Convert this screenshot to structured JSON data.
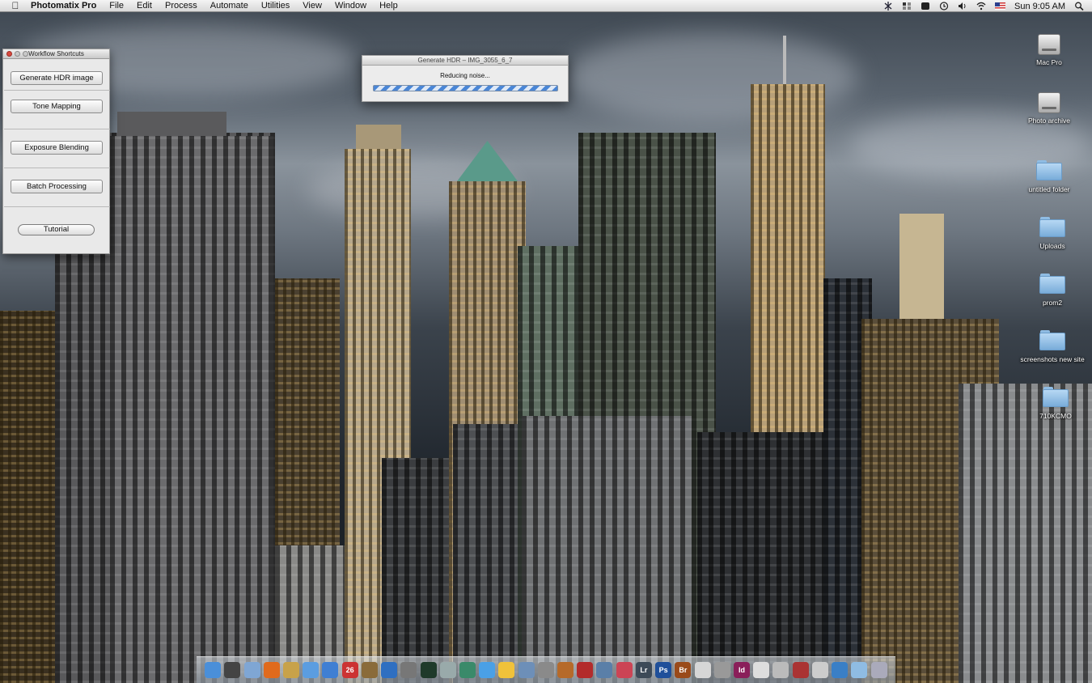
{
  "menubar": {
    "apple_icon": "apple-icon",
    "app_name": "Photomatix Pro",
    "menus": [
      "File",
      "Edit",
      "Process",
      "Automate",
      "Utilities",
      "View",
      "Window",
      "Help"
    ],
    "clock": "Sun 9:05 AM",
    "status_icons": [
      "bluetooth-icon",
      "spaces-icon",
      "timemachine-icon",
      "volume-icon",
      "wifi-icon",
      "us-flag-icon",
      "spotlight-icon"
    ]
  },
  "workflow": {
    "title": "Workflow Shortcuts",
    "buttons": {
      "generate_hdr": "Generate HDR image",
      "tone_mapping": "Tone Mapping",
      "exposure_blending": "Exposure Blending",
      "batch_processing": "Batch Processing",
      "tutorial": "Tutorial"
    }
  },
  "hdr_window": {
    "title": "Generate HDR – IMG_3055_6_7",
    "status": "Reducing noise..."
  },
  "desktop_icons": [
    {
      "label": "Mac Pro",
      "type": "drive"
    },
    {
      "label": "Photo archive",
      "type": "drive"
    },
    {
      "label": "untitled folder",
      "type": "folder"
    },
    {
      "label": "Uploads",
      "type": "folder"
    },
    {
      "label": "prom2",
      "type": "folder"
    },
    {
      "label": "screenshots new site",
      "type": "folder"
    },
    {
      "label": "710KCMO",
      "type": "folder"
    }
  ],
  "dock": {
    "items": [
      {
        "name": "finder-icon",
        "text": "",
        "color": "#4a8fd9"
      },
      {
        "name": "dashboard-icon",
        "text": "",
        "color": "#444"
      },
      {
        "name": "mail-icon",
        "text": "",
        "color": "#7fa6d4"
      },
      {
        "name": "firefox-icon",
        "text": "",
        "color": "#e06a1c"
      },
      {
        "name": "preview-icon",
        "text": "",
        "color": "#c8a24a"
      },
      {
        "name": "ichat-icon",
        "text": "",
        "color": "#5b9de0"
      },
      {
        "name": "itunes-icon",
        "text": "",
        "color": "#3f7fd3"
      },
      {
        "name": "ical-icon",
        "text": "26",
        "color": "#c33"
      },
      {
        "name": "iphoto-icon",
        "text": "",
        "color": "#8a6b3a"
      },
      {
        "name": "quicktime-icon",
        "text": "",
        "color": "#2f6fc1"
      },
      {
        "name": "image-capture-icon",
        "text": "",
        "color": "#777"
      },
      {
        "name": "activity-monitor-icon",
        "text": "",
        "color": "#1f3a2a"
      },
      {
        "name": "airport-utility-icon",
        "text": "",
        "color": "#9aa"
      },
      {
        "name": "network-icon",
        "text": "",
        "color": "#3a8a6a"
      },
      {
        "name": "safari-icon",
        "text": "",
        "color": "#4aa0e6"
      },
      {
        "name": "adium-icon",
        "text": "",
        "color": "#f0c23a"
      },
      {
        "name": "textedit-icon",
        "text": "",
        "color": "#6d8fb8"
      },
      {
        "name": "utilities-icon",
        "text": "",
        "color": "#8a8a8a"
      },
      {
        "name": "photomatix-icon",
        "text": "",
        "color": "#b66a2a"
      },
      {
        "name": "photobooth-icon",
        "text": "",
        "color": "#b32b2b"
      },
      {
        "name": "timemachine-icon",
        "text": "",
        "color": "#5a7fa8"
      },
      {
        "name": "system-prefs-icon",
        "text": "",
        "color": "#c45"
      },
      {
        "name": "lightroom-icon",
        "text": "Lr",
        "color": "#3d4a58"
      },
      {
        "name": "photoshop-icon",
        "text": "Ps",
        "color": "#1f4f9a"
      },
      {
        "name": "bridge-icon",
        "text": "Br",
        "color": "#9a4a1a"
      },
      {
        "name": "acrobat-icon",
        "text": "",
        "color": "#d6d6d6"
      },
      {
        "name": "app-icon",
        "text": "",
        "color": "#999"
      },
      {
        "name": "indesign-icon",
        "text": "Id",
        "color": "#8a1f5a"
      },
      {
        "name": "documents-stack-icon",
        "text": "",
        "color": "#ddd"
      },
      {
        "name": "downloads-stack-icon",
        "text": "",
        "color": "#bbb"
      },
      {
        "name": "photo-stack-icon",
        "text": "",
        "color": "#a33"
      },
      {
        "name": "pdf-stack-icon",
        "text": "",
        "color": "#ccc"
      },
      {
        "name": "network-globe-icon",
        "text": "",
        "color": "#3a7fc6"
      },
      {
        "name": "folder-stack-icon",
        "text": "",
        "color": "#8fbce3"
      },
      {
        "name": "trash-icon",
        "text": "",
        "color": "#aab"
      }
    ]
  }
}
